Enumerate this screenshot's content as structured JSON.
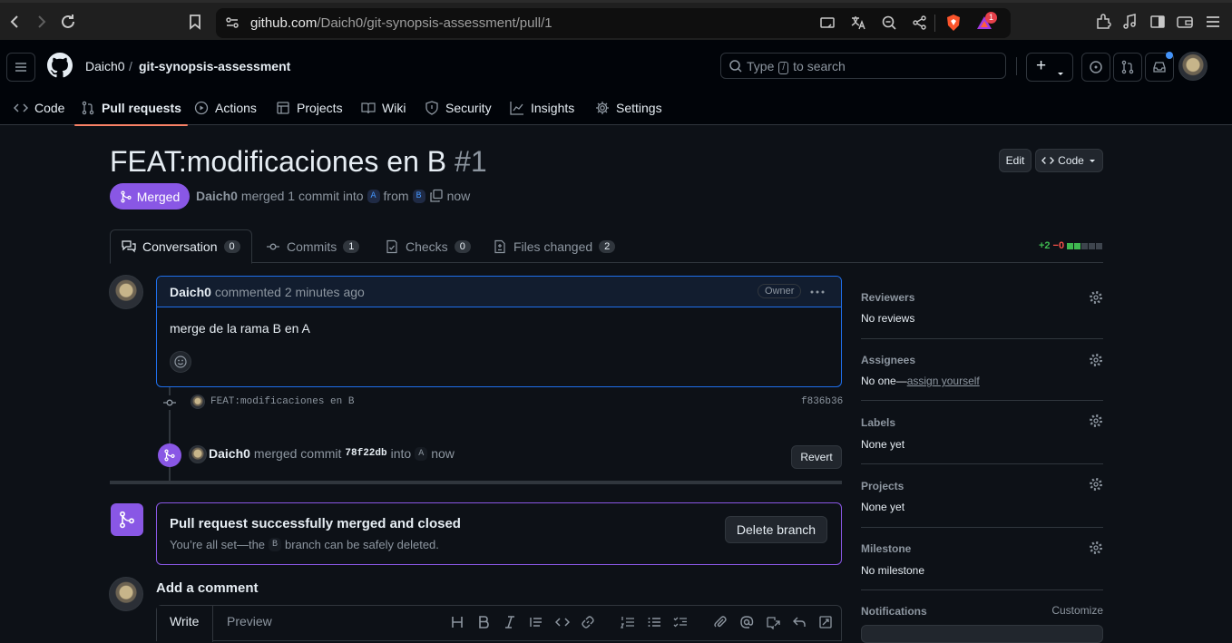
{
  "browser": {
    "url_host": "github.com",
    "url_path": "/Daich0/git-synopsis-assessment/pull/1",
    "brave_badge": "1"
  },
  "header": {
    "owner": "Daich0",
    "separator": "/",
    "repo": "git-synopsis-assessment",
    "search_prefix": "Type",
    "search_key": "/",
    "search_suffix": "to search",
    "new_symbol": "+"
  },
  "repo_tabs": [
    {
      "label": "Code",
      "icon": "code-icon"
    },
    {
      "label": "Pull requests",
      "icon": "git-pull-request-icon"
    },
    {
      "label": "Actions",
      "icon": "play-icon"
    },
    {
      "label": "Projects",
      "icon": "table-icon"
    },
    {
      "label": "Wiki",
      "icon": "book-icon"
    },
    {
      "label": "Security",
      "icon": "shield-icon"
    },
    {
      "label": "Insights",
      "icon": "graph-icon"
    },
    {
      "label": "Settings",
      "icon": "gear-icon"
    }
  ],
  "pr": {
    "title": "FEAT:modificaciones en B",
    "number": "#1",
    "edit_label": "Edit",
    "code_label": "Code",
    "state": "Merged",
    "author": "Daich0",
    "merged_text": "merged 1 commit into",
    "base_branch": "A",
    "from_text": "from",
    "head_branch": "B",
    "time": "now"
  },
  "pr_tabs": [
    {
      "label": "Conversation",
      "count": "0"
    },
    {
      "label": "Commits",
      "count": "1"
    },
    {
      "label": "Checks",
      "count": "0"
    },
    {
      "label": "Files changed",
      "count": "2"
    }
  ],
  "diffstat": {
    "added": "+2",
    "removed": "−0"
  },
  "comment": {
    "author": "Daich0",
    "action": "commented",
    "time": "2 minutes ago",
    "role": "Owner",
    "body": "merge de la rama B en A"
  },
  "commit_event": {
    "message": "FEAT:modificaciones en B",
    "sha": "f836b36"
  },
  "merge_event": {
    "author": "Daich0",
    "text": "merged commit",
    "sha": "78f22db",
    "into_text": "into",
    "branch": "A",
    "time": "now",
    "revert_label": "Revert"
  },
  "merge_box": {
    "title": "Pull request successfully merged and closed",
    "desc_before": "You’re all set—the",
    "branch": "B",
    "desc_after": "branch can be safely deleted.",
    "delete_label": "Delete branch"
  },
  "add_comment": {
    "title": "Add a comment",
    "write_tab": "Write",
    "preview_tab": "Preview"
  },
  "sidebar": {
    "reviewers": {
      "title": "Reviewers",
      "value": "No reviews"
    },
    "assignees": {
      "title": "Assignees",
      "value": "No one—",
      "link": "assign yourself"
    },
    "labels": {
      "title": "Labels",
      "value": "None yet"
    },
    "projects": {
      "title": "Projects",
      "value": "None yet"
    },
    "milestone": {
      "title": "Milestone",
      "value": "No milestone"
    },
    "notifications": {
      "title": "Notifications",
      "action": "Customize"
    }
  },
  "colors": {
    "merged_purple": "#8957e5",
    "accent_blue": "#1f6feb",
    "tab_underline": "#f78166",
    "add_green": "#3fb950",
    "del_red": "#f85149"
  }
}
